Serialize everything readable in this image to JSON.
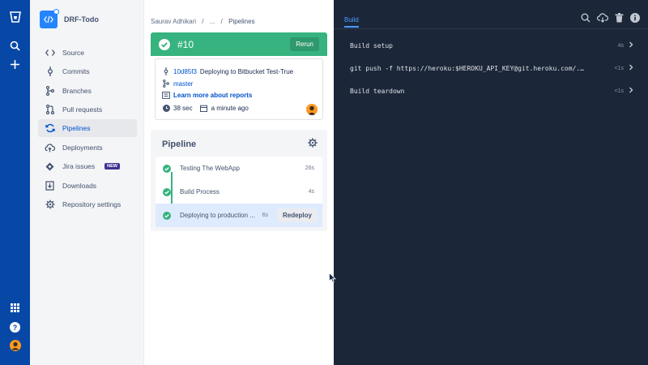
{
  "global_nav": {
    "icons": [
      "bitbucket-logo",
      "search-icon",
      "plus-icon",
      "apps-grid-icon",
      "help-icon",
      "user-avatar"
    ]
  },
  "sidebar": {
    "repo_name": "DRF-Todo",
    "items": [
      {
        "label": "Source",
        "icon": "code-icon"
      },
      {
        "label": "Commits",
        "icon": "commit-icon"
      },
      {
        "label": "Branches",
        "icon": "branch-icon"
      },
      {
        "label": "Pull requests",
        "icon": "pull-request-icon"
      },
      {
        "label": "Pipelines",
        "icon": "pipelines-icon",
        "active": true
      },
      {
        "label": "Deployments",
        "icon": "cloud-icon"
      },
      {
        "label": "Jira issues",
        "icon": "jira-icon",
        "badge": "NEW"
      },
      {
        "label": "Downloads",
        "icon": "download-icon"
      },
      {
        "label": "Repository settings",
        "icon": "gear-icon"
      }
    ]
  },
  "breadcrumb": {
    "owner": "Saurav Adhikari",
    "sep1": "/",
    "middle": "...",
    "sep2": "/",
    "current": "Pipelines"
  },
  "build": {
    "number": "#10",
    "rerun_label": "Rerun",
    "commit_hash": "10d85f3",
    "commit_message": "Deploying to Bitbucket Test-True",
    "branch": "master",
    "reports_link": "Learn more about reports",
    "duration": "38 sec",
    "time_ago": "a minute ago"
  },
  "pipeline": {
    "title": "Pipeline",
    "steps": [
      {
        "label": "Testing The WebApp",
        "duration": "26s"
      },
      {
        "label": "Build Process",
        "duration": "4s"
      },
      {
        "label": "Deploying to production ...",
        "duration": "6s",
        "action": "Redeploy",
        "active": true
      }
    ]
  },
  "logs": {
    "tab": "Build",
    "rows": [
      {
        "text": "Build setup",
        "duration": "4s"
      },
      {
        "text": "git push -f https://heroku:$HEROKU_API_KEY@git.heroku.com/...",
        "duration": "<1s"
      },
      {
        "text": "Build teardown",
        "duration": "<1s"
      }
    ]
  },
  "colors": {
    "global_nav": "#0747a6",
    "success": "#36b37e",
    "link": "#0052cc",
    "logs_bg": "#1b2638",
    "new_badge": "#403294"
  }
}
